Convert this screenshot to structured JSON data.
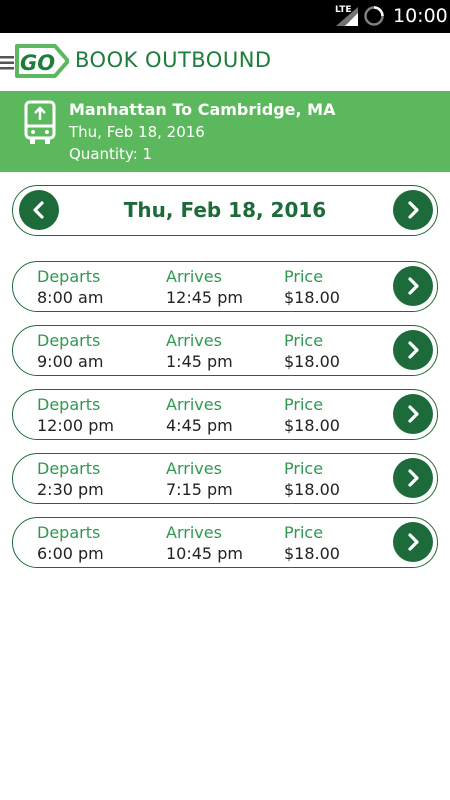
{
  "status_bar": {
    "network": "LTE",
    "time": "10:00"
  },
  "header": {
    "logo_text": "GO",
    "title": "BOOK OUTBOUND"
  },
  "trip": {
    "route": "Manhattan To Cambridge, MA",
    "date": "Thu, Feb 18, 2016",
    "quantity": "Quantity: 1"
  },
  "date_picker": {
    "date": "Thu, Feb 18, 2016"
  },
  "labels": {
    "departs": "Departs",
    "arrives": "Arrives",
    "price": "Price"
  },
  "trips": [
    {
      "departs": "8:00 am",
      "arrives": "12:45 pm",
      "price": "$18.00"
    },
    {
      "departs": "9:00 am",
      "arrives": "1:45 pm",
      "price": "$18.00"
    },
    {
      "departs": "12:00 pm",
      "arrives": "4:45 pm",
      "price": "$18.00"
    },
    {
      "departs": "2:30 pm",
      "arrives": "7:15 pm",
      "price": "$18.00"
    },
    {
      "departs": "6:00 pm",
      "arrives": "10:45 pm",
      "price": "$18.00"
    }
  ],
  "icons": {
    "menu": "menu-icon",
    "bus": "bus-icon",
    "prev": "chevron-left-icon",
    "next": "chevron-right-icon"
  },
  "colors": {
    "brand_green": "#5cb85c",
    "dark_green": "#1d6b3a",
    "label_green": "#2e9a4e"
  }
}
